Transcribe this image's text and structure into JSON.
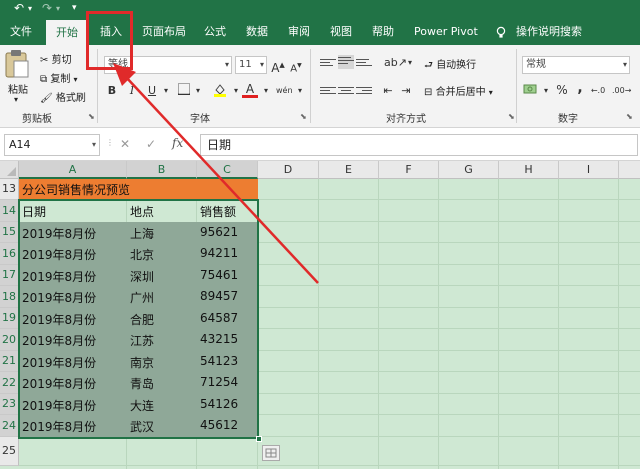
{
  "titlebar": {
    "undo_icon": "↶",
    "redo_icon": "↷",
    "customize_icon": "▾"
  },
  "tabs": [
    "文件",
    "开始",
    "插入",
    "页面布局",
    "公式",
    "数据",
    "审阅",
    "视图",
    "帮助",
    "Power Pivot",
    "操作说明搜索"
  ],
  "ribbon": {
    "clipboard": {
      "paste": "粘贴",
      "cut": "剪切",
      "copy": "复制",
      "format_painter": "格式刷",
      "group_label": "剪贴板"
    },
    "font": {
      "font_name": "等线",
      "font_size": "11",
      "bold": "B",
      "italic": "I",
      "underline": "U",
      "grow": "A",
      "shrink": "A",
      "phonetic": "wén",
      "font_color": "A",
      "group_label": "字体"
    },
    "alignment": {
      "wrap_text": "自动换行",
      "merge_center": "合并后居中",
      "group_label": "对齐方式"
    },
    "number": {
      "format": "常规",
      "percent": "%",
      "comma": ",",
      "group_label": "数字"
    }
  },
  "formula_bar": {
    "name_box": "A14",
    "cancel": "✕",
    "enter": "✓",
    "fx": "fx",
    "value": "日期"
  },
  "grid": {
    "columns": [
      "A",
      "B",
      "C",
      "D",
      "E",
      "F",
      "G",
      "H",
      "I"
    ],
    "rows": [
      "13",
      "14",
      "15",
      "16",
      "17",
      "18",
      "19",
      "20",
      "21",
      "22",
      "23",
      "24",
      "25"
    ],
    "title_cell": "分公司销售情况预览",
    "headers": [
      "日期",
      "地点",
      "销售额"
    ],
    "data": [
      [
        "2019年8月份",
        "上海",
        "95621"
      ],
      [
        "2019年8月份",
        "北京",
        "94211"
      ],
      [
        "2019年8月份",
        "深圳",
        "75461"
      ],
      [
        "2019年8月份",
        "广州",
        "89457"
      ],
      [
        "2019年8月份",
        "合肥",
        "64587"
      ],
      [
        "2019年8月份",
        "江苏",
        "43215"
      ],
      [
        "2019年8月份",
        "南京",
        "54123"
      ],
      [
        "2019年8月份",
        "青岛",
        "71254"
      ],
      [
        "2019年8月份",
        "大连",
        "54126"
      ],
      [
        "2019年8月份",
        "武汉",
        "45612"
      ]
    ]
  },
  "colors": {
    "excel_green": "#217346",
    "title_row": "#ed7d31",
    "header_row": "#cfe8d3",
    "selection_fill": "#8fa898",
    "annotation_red": "#e02a2a"
  }
}
